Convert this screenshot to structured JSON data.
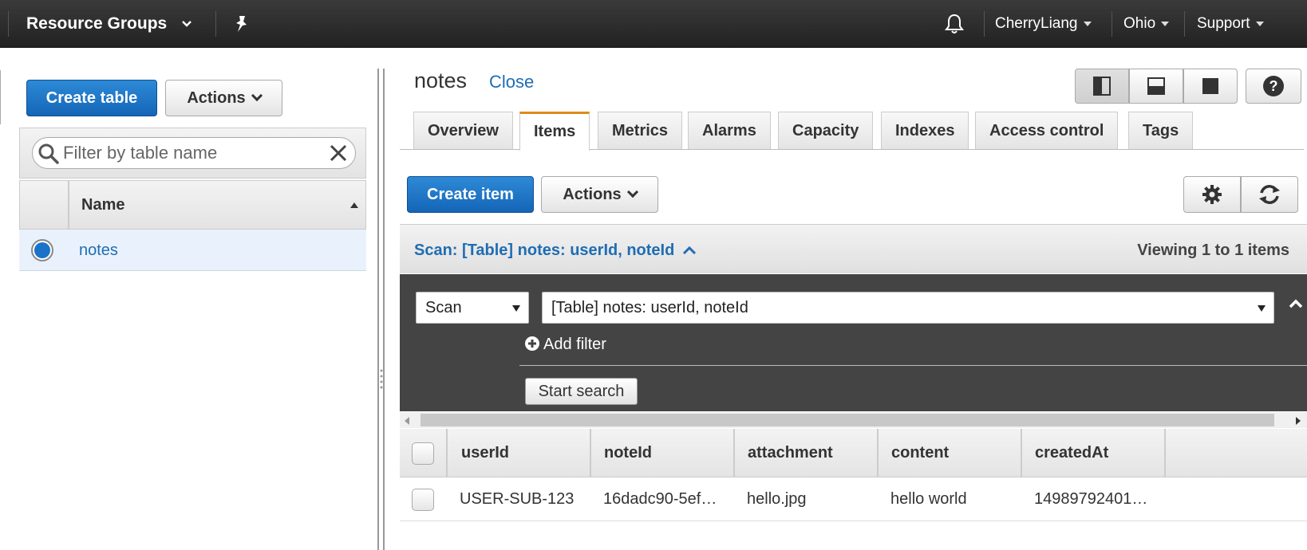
{
  "topbar": {
    "resource_groups": "Resource Groups",
    "user": "CherryLiang",
    "region": "Ohio",
    "support": "Support"
  },
  "left": {
    "create_table": "Create table",
    "actions": "Actions",
    "filter_placeholder": "Filter by table name",
    "name_header": "Name",
    "tables": [
      {
        "name": "notes",
        "selected": true
      }
    ]
  },
  "right": {
    "table_name": "notes",
    "close": "Close",
    "tabs": [
      "Overview",
      "Items",
      "Metrics",
      "Alarms",
      "Capacity",
      "Indexes",
      "Access control",
      "Tags"
    ],
    "active_tab": "Items",
    "create_item": "Create item",
    "actions": "Actions",
    "scan_summary": "Scan: [Table] notes: userId, noteId",
    "viewing": "Viewing 1 to 1 items",
    "scan_mode": "Scan",
    "scan_target": "[Table] notes: userId, noteId",
    "add_filter": "Add filter",
    "start_search": "Start search",
    "columns": [
      "userId",
      "noteId",
      "attachment",
      "content",
      "createdAt"
    ],
    "rows": [
      {
        "userId": "USER-SUB-123",
        "noteId": "16dadc90-5ef…",
        "attachment": "hello.jpg",
        "content": "hello world",
        "createdAt": "14989792401…"
      }
    ]
  },
  "colors": {
    "topbar": "#2b2b2b",
    "primary": "#1a6fc4",
    "link": "#1f6db3",
    "active_tab_accent": "#e0891a",
    "search_panel": "#444444",
    "selected_row": "#e9f2fc"
  }
}
